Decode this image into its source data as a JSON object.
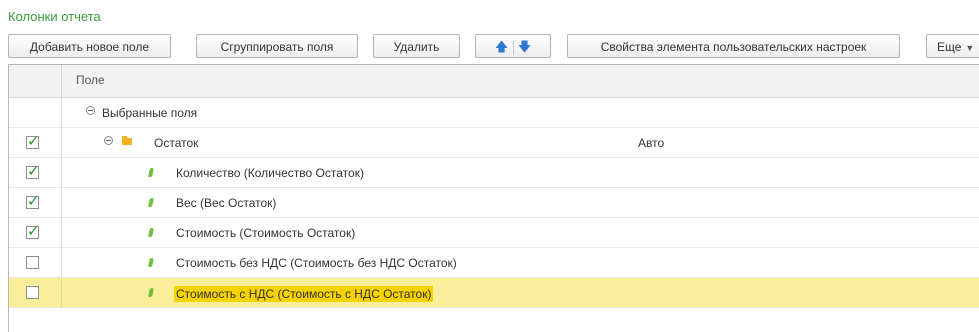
{
  "panel": {
    "title": "Колонки отчета"
  },
  "toolbar": {
    "add_label": "Добавить новое поле",
    "group_label": "Сгруппировать поля",
    "delete_label": "Удалить",
    "up_icon": "arrow-up-icon",
    "down_icon": "arrow-down-icon",
    "props_label": "Свойства элемента пользовательских настроек",
    "more_label": "Еще"
  },
  "grid": {
    "header": {
      "field": "Поле"
    },
    "rows": [
      {
        "label": "Выбранные поля",
        "checked": null,
        "value": ""
      },
      {
        "label": "Остаток",
        "checked": true,
        "value": "Авто"
      },
      {
        "label": "Количество (Количество Остаток)",
        "checked": true,
        "value": ""
      },
      {
        "label": "Вес (Вес Остаток)",
        "checked": true,
        "value": ""
      },
      {
        "label": "Стоимость (Стоимость Остаток)",
        "checked": true,
        "value": ""
      },
      {
        "label": "Стоимость без НДС (Стоимость без НДС Остаток)",
        "checked": false,
        "value": ""
      },
      {
        "label": "Стоимость с НДС (Стоимость с НДС Остаток)",
        "checked": false,
        "value": "",
        "selected": true
      }
    ]
  },
  "colors": {
    "title": "#3a9d3a",
    "selection": "#fbee9b",
    "text_highlight": "#f6d200"
  }
}
